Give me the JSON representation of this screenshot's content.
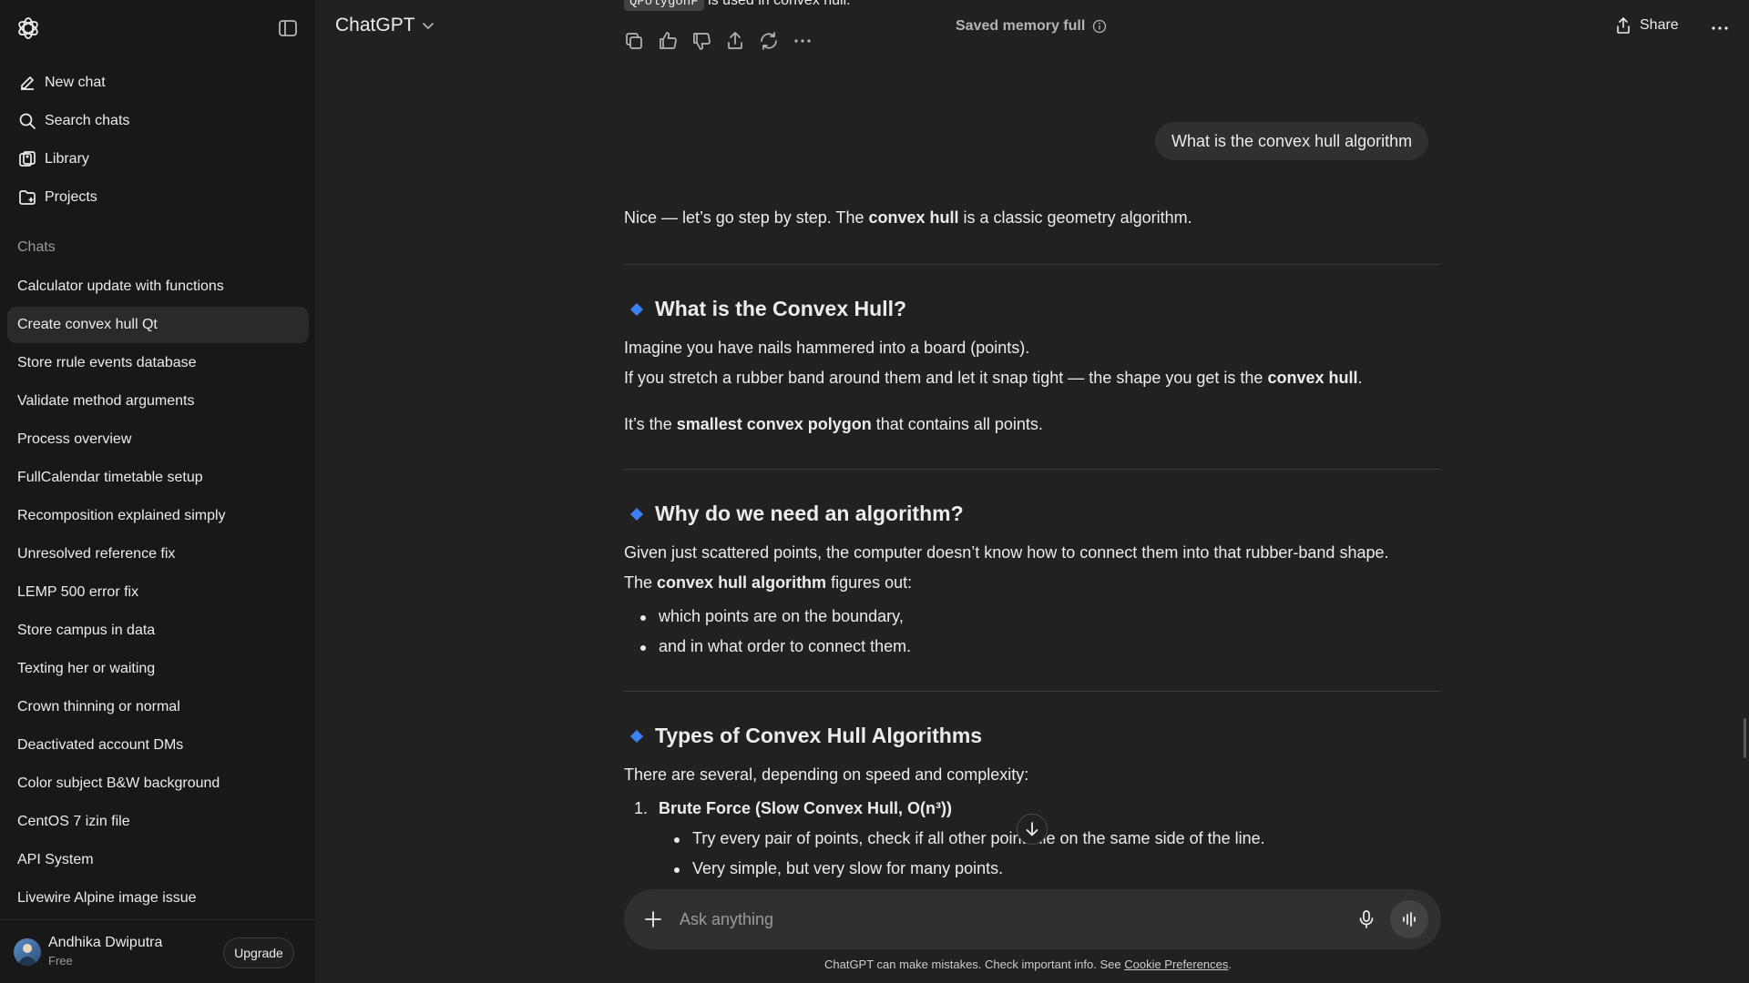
{
  "app": {
    "title": "ChatGPT"
  },
  "sidebar": {
    "nav": [
      {
        "label": "New chat",
        "icon": "edit-icon"
      },
      {
        "label": "Search chats",
        "icon": "search-icon"
      },
      {
        "label": "Library",
        "icon": "library-icon"
      },
      {
        "label": "Projects",
        "icon": "folder-icon"
      }
    ],
    "section_label": "Chats",
    "chats": [
      "Calculator update with functions",
      "Create convex hull Qt",
      "Store rrule events database",
      "Validate method arguments",
      "Process overview",
      "FullCalendar timetable setup",
      "Recomposition explained simply",
      "Unresolved reference fix",
      "LEMP 500 error fix",
      "Store campus in data",
      "Texting her or waiting",
      "Crown thinning or normal",
      "Deactivated account DMs",
      "Color subject B&W background",
      "CentOS 7 izin file",
      "API System",
      "Livewire Alpine image issue"
    ],
    "active_chat": "Create convex hull Qt",
    "user": {
      "name": "Andhika Dwiputra",
      "plan": "Free",
      "upgrade_label": "Upgrade"
    }
  },
  "header": {
    "model": "ChatGPT",
    "memory_status": "Saved memory full",
    "share_label": "Share"
  },
  "conversation": {
    "top_fragment": {
      "code": "QPolygonF",
      "text": "is used in convex hull."
    },
    "user_message": "What is the convex hull algorithm",
    "intro": {
      "pre": "Nice — let’s go step by step. The ",
      "bold": "convex hull",
      "post": " is a classic geometry algorithm."
    },
    "sections": [
      {
        "heading": "What is the Convex Hull?",
        "line1": "Imagine you have nails hammered into a board (points).",
        "line2_pre": "If you stretch a rubber band around them and let it snap tight — the shape you get is the ",
        "line2_bold": "convex hull",
        "line2_post": ".",
        "line3_pre": "It’s the ",
        "line3_bold": "smallest convex polygon",
        "line3_post": " that contains all points."
      },
      {
        "heading": "Why do we need an algorithm?",
        "line1": "Given just scattered points, the computer doesn’t know how to connect them into that rubber-band shape.",
        "line2_pre": "The ",
        "line2_bold": "convex hull algorithm",
        "line2_post": " figures out:",
        "bullets": [
          "which points are on the boundary,",
          "and in what order to connect them."
        ]
      },
      {
        "heading": "Types of Convex Hull Algorithms",
        "line1": "There are several, depending on speed and complexity:",
        "item1_num": "1.",
        "item1_title": "Brute Force (Slow Convex Hull, O(n³))",
        "item1_bullets": [
          "Try every pair of points, check if all other points lie on the same side of the line.",
          "Very simple, but very slow for many points."
        ]
      }
    ]
  },
  "composer": {
    "placeholder": "Ask anything"
  },
  "footer": {
    "disclaimer": "ChatGPT can make mistakes. Check important info. See ",
    "link": "Cookie Preferences",
    "end": "."
  },
  "colors": {
    "background": "#212121",
    "sidebar": "#181818",
    "bubble": "#303030",
    "accent_diamond": "#3b82f6"
  }
}
